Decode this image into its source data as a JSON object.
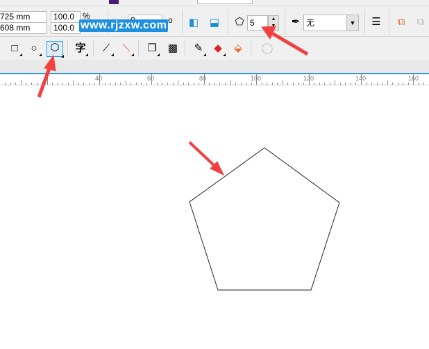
{
  "property_bar": {
    "width_value": "725 mm",
    "height_value": "608 mm",
    "scale_x": "100.0",
    "scale_y": "100.0",
    "percent_unit": "%",
    "rotation_value": "0",
    "degree_symbol": "o",
    "polygon_points": "5",
    "outline_width": "无"
  },
  "toolbox": {
    "text_tool_glyph": "字",
    "active_tool": "polygon-tool"
  },
  "ruler": {
    "labels": [
      "40",
      "60",
      "80",
      "100",
      "120",
      "140",
      "160"
    ]
  },
  "watermark": "www.rjzxw.com",
  "colors": {
    "accent": "#2a9ad6",
    "arrow": "#f04040",
    "selected_tool_bg": "#dceefc"
  }
}
